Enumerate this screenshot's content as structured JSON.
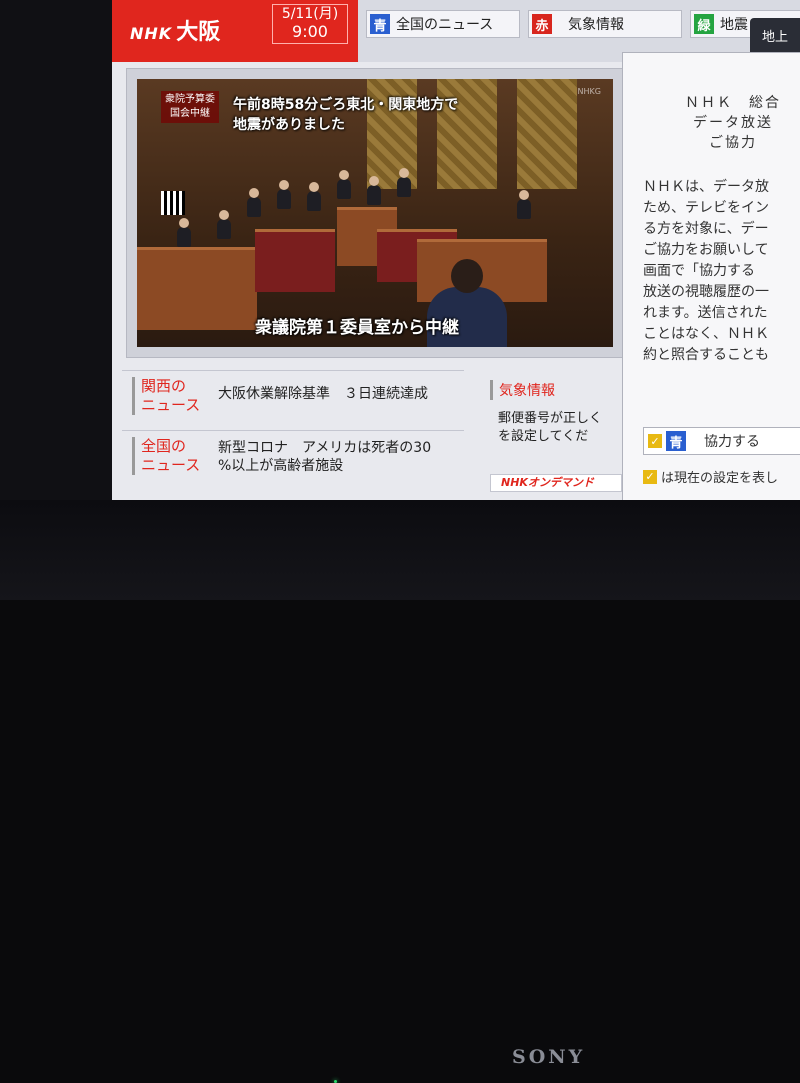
{
  "header": {
    "logo_brand": "NHK",
    "logo_region": "大阪",
    "date": "5/11(月)",
    "time": "9:00"
  },
  "topbar": {
    "buttons": [
      {
        "key": "青",
        "label": "全国のニュース"
      },
      {
        "key": "赤",
        "label": "気象情報"
      },
      {
        "key": "緑",
        "label": "地震"
      }
    ],
    "dark_tab": "地上"
  },
  "video": {
    "program_tag": "衆院予算委\n国会中継",
    "headline": "午前8時58分ごろ東北・関東地方で\n地震がありました",
    "location_caption": "衆議院第１委員室から中継",
    "channel_mark": "NHKG"
  },
  "news": [
    {
      "category": "関西の\nニュース",
      "text": "大阪休業解除基準　３日連続達成"
    },
    {
      "category": "全国の\nニュース",
      "text": "新型コロナ　アメリカは死者の30\n%以上が高齢者施設"
    }
  ],
  "weather": {
    "title": "気象情報",
    "text": "郵便番号が正しく\nを設定してくだ",
    "ondemand": "NHKオンデマンド"
  },
  "dialog": {
    "title": "ＮＨＫ　総合\nデータ放送\nご協力",
    "body": "ＮＨＫは、データ放\nため、テレビをイン\nる方を対象に、デー\nご協力をお願いして\n画面で「協力する\n放送の視聴履歴の一\nれます。送信された\nことはなく、ＮＨＫ\n約と照合することも",
    "agree_key": "青",
    "agree_label": "協力する",
    "note": "は現在の設定を表し"
  },
  "tv": {
    "brand": "SONY"
  }
}
